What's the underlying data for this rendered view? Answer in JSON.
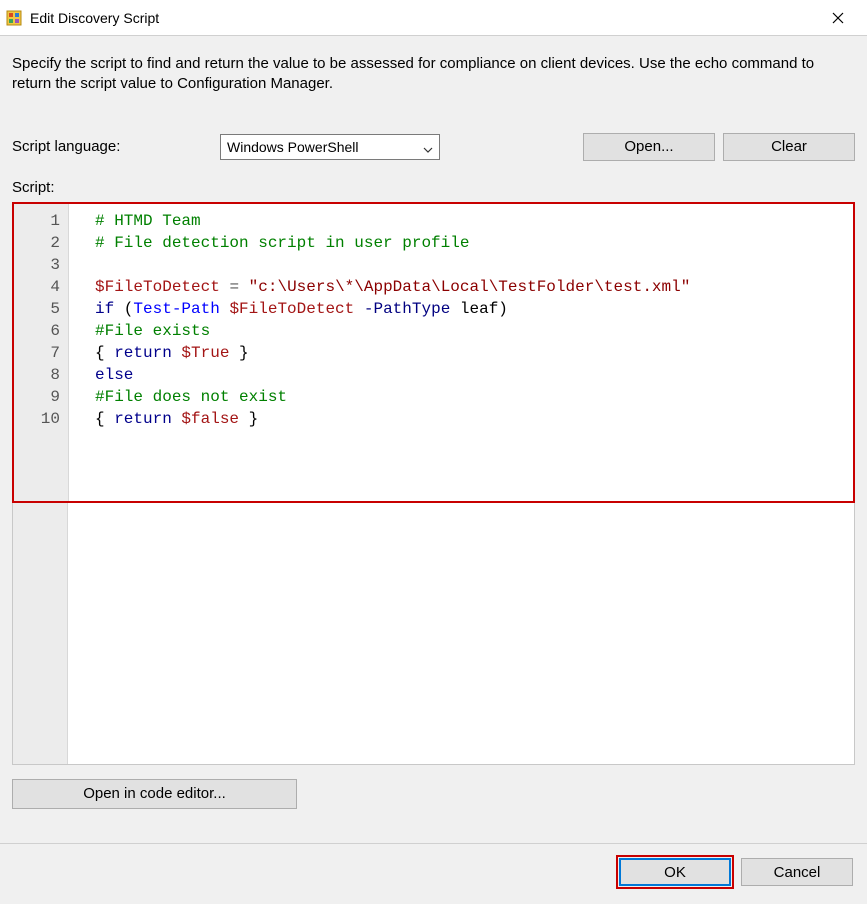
{
  "window": {
    "title": "Edit Discovery Script"
  },
  "instructions": "Specify the script to find and return the value to be assessed for compliance on client devices. Use the echo command to return the script value to Configuration Manager.",
  "labels": {
    "script_language": "Script language:",
    "script": "Script:"
  },
  "language_select": {
    "value": "Windows PowerShell"
  },
  "buttons": {
    "open": "Open...",
    "clear": "Clear",
    "open_in_editor": "Open in code editor...",
    "ok": "OK",
    "cancel": "Cancel"
  },
  "script": {
    "line_numbers": [
      "1",
      "2",
      "3",
      "4",
      "5",
      "6",
      "7",
      "8",
      "9",
      "10"
    ],
    "lines": [
      [
        {
          "cls": "tok-comment",
          "t": "# HTMD Team"
        }
      ],
      [
        {
          "cls": "tok-comment",
          "t": "# File detection script in user profile"
        }
      ],
      [],
      [
        {
          "cls": "tok-var",
          "t": "$FileToDetect"
        },
        {
          "cls": "tok-plain",
          "t": " "
        },
        {
          "cls": "tok-op",
          "t": "="
        },
        {
          "cls": "tok-plain",
          "t": " "
        },
        {
          "cls": "tok-string",
          "t": "\"c:\\Users\\*\\AppData\\Local\\TestFolder\\test.xml\""
        }
      ],
      [
        {
          "cls": "tok-keyword",
          "t": "if"
        },
        {
          "cls": "tok-plain",
          "t": " ("
        },
        {
          "cls": "tok-cmdlet",
          "t": "Test-Path"
        },
        {
          "cls": "tok-plain",
          "t": " "
        },
        {
          "cls": "tok-var",
          "t": "$FileToDetect"
        },
        {
          "cls": "tok-plain",
          "t": " "
        },
        {
          "cls": "tok-param",
          "t": "-PathType"
        },
        {
          "cls": "tok-plain",
          "t": " leaf)"
        }
      ],
      [
        {
          "cls": "tok-comment",
          "t": "#File exists"
        }
      ],
      [
        {
          "cls": "tok-plain",
          "t": "{ "
        },
        {
          "cls": "tok-keyword",
          "t": "return"
        },
        {
          "cls": "tok-plain",
          "t": " "
        },
        {
          "cls": "tok-var",
          "t": "$True"
        },
        {
          "cls": "tok-plain",
          "t": " }"
        }
      ],
      [
        {
          "cls": "tok-keyword",
          "t": "else"
        }
      ],
      [
        {
          "cls": "tok-comment",
          "t": "#File does not exist"
        }
      ],
      [
        {
          "cls": "tok-plain",
          "t": "{ "
        },
        {
          "cls": "tok-keyword",
          "t": "return"
        },
        {
          "cls": "tok-plain",
          "t": " "
        },
        {
          "cls": "tok-var",
          "t": "$false"
        },
        {
          "cls": "tok-plain",
          "t": " }"
        }
      ]
    ]
  },
  "colors": {
    "highlight_border": "#c80000",
    "focus_border": "#0078d7"
  }
}
